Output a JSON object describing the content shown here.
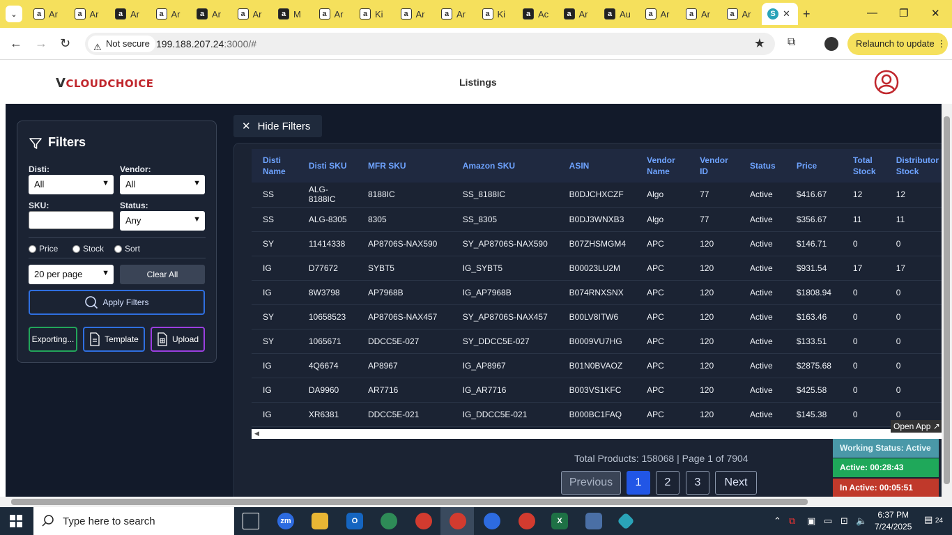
{
  "browser": {
    "tabs": [
      {
        "label": "Ar",
        "icon": "a"
      },
      {
        "label": "Ar",
        "icon": "a"
      },
      {
        "label": "Ar",
        "icon": "a"
      },
      {
        "label": "Ar",
        "icon": "a"
      },
      {
        "label": "Ar",
        "icon": "a"
      },
      {
        "label": "Ar",
        "icon": "a"
      },
      {
        "label": "M",
        "icon": "a"
      },
      {
        "label": "Ar",
        "icon": "a"
      },
      {
        "label": "Ki",
        "icon": "a"
      },
      {
        "label": "Ar",
        "icon": "a"
      },
      {
        "label": "Ar",
        "icon": "a"
      },
      {
        "label": "Ki",
        "icon": "a"
      },
      {
        "label": "Ac",
        "icon": "a"
      },
      {
        "label": "Ar",
        "icon": "a"
      },
      {
        "label": "Au",
        "icon": "a"
      },
      {
        "label": "Ar",
        "icon": "a"
      },
      {
        "label": "Ar",
        "icon": "a"
      },
      {
        "label": "Ar",
        "icon": "a"
      }
    ],
    "active_tab_icon": "S",
    "not_secure": "Not secure",
    "url_host": "199.188.207.24",
    "url_path": ":3000/#",
    "relaunch": "Relaunch to update"
  },
  "app": {
    "logo_v": "V",
    "logo_text": "CLOUDCHOICE",
    "page_title": "Listings"
  },
  "filters": {
    "title": "Filters",
    "disti_label": "Disti:",
    "disti_value": "All",
    "vendor_label": "Vendor:",
    "vendor_value": "All",
    "sku_label": "SKU:",
    "sku_value": "",
    "status_label": "Status:",
    "status_value": "Any",
    "sort_options": [
      "Price",
      "Stock",
      "Sort"
    ],
    "per_page": "20 per page",
    "clear_all": "Clear All",
    "apply": "Apply Filters",
    "export": "Exporting...",
    "template": "Template",
    "upload": "Upload"
  },
  "hide_filters": "Hide Filters",
  "table": {
    "headers": [
      "Disti Name",
      "Disti SKU",
      "MFR SKU",
      "Amazon SKU",
      "ASIN",
      "Vendor Name",
      "Vendor ID",
      "Status",
      "Price",
      "Total Stock",
      "Distributor Stock"
    ],
    "rows": [
      [
        "SS",
        "ALG-8188IC",
        "8188IC",
        "SS_8188IC",
        "B0DJCHXCZF",
        "Algo",
        "77",
        "Active",
        "$416.67",
        "12",
        "12"
      ],
      [
        "SS",
        "ALG-8305",
        "8305",
        "SS_8305",
        "B0DJ3WNXB3",
        "Algo",
        "77",
        "Active",
        "$356.67",
        "11",
        "11"
      ],
      [
        "SY",
        "11414338",
        "AP8706S-NAX590",
        "SY_AP8706S-NAX590",
        "B07ZHSMGM4",
        "APC",
        "120",
        "Active",
        "$146.71",
        "0",
        "0"
      ],
      [
        "IG",
        "D77672",
        "SYBT5",
        "IG_SYBT5",
        "B00023LU2M",
        "APC",
        "120",
        "Active",
        "$931.54",
        "17",
        "17"
      ],
      [
        "IG",
        "8W3798",
        "AP7968B",
        "IG_AP7968B",
        "B074RNXSNX",
        "APC",
        "120",
        "Active",
        "$1808.94",
        "0",
        "0"
      ],
      [
        "SY",
        "10658523",
        "AP8706S-NAX457",
        "SY_AP8706S-NAX457",
        "B00LV8ITW6",
        "APC",
        "120",
        "Active",
        "$163.46",
        "0",
        "0"
      ],
      [
        "SY",
        "1065671",
        "DDCC5E-027",
        "SY_DDCC5E-027",
        "B0009VU7HG",
        "APC",
        "120",
        "Active",
        "$133.51",
        "0",
        "0"
      ],
      [
        "IG",
        "4Q6674",
        "AP8967",
        "IG_AP8967",
        "B01N0BVAOZ",
        "APC",
        "120",
        "Active",
        "$2875.68",
        "0",
        "0"
      ],
      [
        "IG",
        "DA9960",
        "AR7716",
        "IG_AR7716",
        "B003VS1KFC",
        "APC",
        "120",
        "Active",
        "$425.58",
        "0",
        "0"
      ],
      [
        "IG",
        "XR6381",
        "DDCC5E-021",
        "IG_DDCC5E-021",
        "B000BC1FAQ",
        "APC",
        "120",
        "Active",
        "$145.38",
        "0",
        "0"
      ]
    ]
  },
  "pagination": {
    "total": "Total Products: 158068 | Page 1 of 7904",
    "previous": "Previous",
    "pages": [
      "1",
      "2",
      "3"
    ],
    "next": "Next"
  },
  "widget": {
    "open_app": "Open App ↗",
    "working": "Working Status: Active",
    "active": "Active: 00:28:43",
    "inactive": "In Active: 00:05:51"
  },
  "taskbar": {
    "search_placeholder": "Type here to search",
    "time": "6:37 PM",
    "date": "7/24/2025",
    "notifications": "24"
  },
  "colors": {
    "tabstrip": "#f5e05c",
    "main_bg": "#121a2a",
    "panel_bg": "#1b2333",
    "header_text": "#6ea3ff",
    "accent_blue": "#2156e6",
    "green": "#1fa85a",
    "red": "#c0392b",
    "teal": "#4a98a8"
  }
}
